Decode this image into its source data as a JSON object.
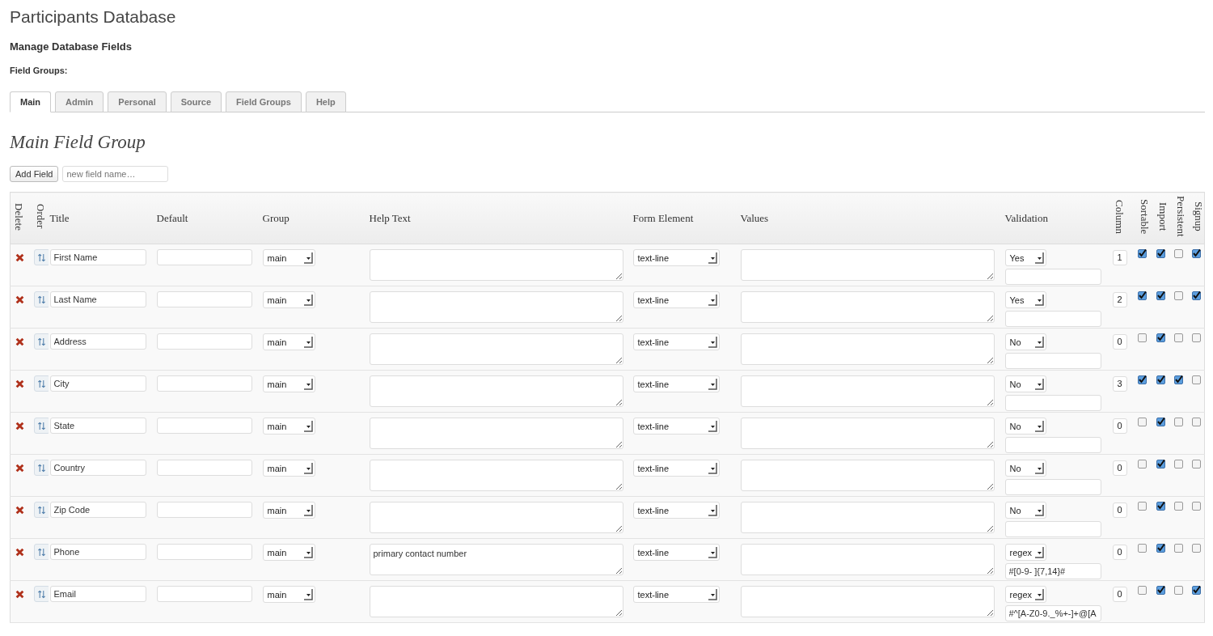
{
  "page_title": "Participants Database",
  "subtitle": "Manage Database Fields",
  "field_groups_label": "Field Groups:",
  "tabs": [
    {
      "label": "Main",
      "selected": true
    },
    {
      "label": "Admin",
      "selected": false
    },
    {
      "label": "Personal",
      "selected": false
    },
    {
      "label": "Source",
      "selected": false
    },
    {
      "label": "Field Groups",
      "selected": false
    },
    {
      "label": "Help",
      "selected": false
    }
  ],
  "section_title": "Main Field Group",
  "add_field": {
    "button": "Add Field",
    "placeholder": "new field name…"
  },
  "table": {
    "columns": [
      "Delete",
      "Order",
      "Title",
      "Default",
      "Group",
      "Help Text",
      "Form Element",
      "Values",
      "Validation",
      "Column",
      "Sortable",
      "Import",
      "Persistent",
      "Signup"
    ],
    "rows": [
      {
        "title": "First Name",
        "group": "main",
        "help": "",
        "element": "text-line",
        "validation": "Yes",
        "regex": "",
        "column": "1",
        "sortable": true,
        "import": true,
        "persistent": false,
        "signup": true
      },
      {
        "title": "Last Name",
        "group": "main",
        "help": "",
        "element": "text-line",
        "validation": "Yes",
        "regex": "",
        "column": "2",
        "sortable": true,
        "import": true,
        "persistent": false,
        "signup": true
      },
      {
        "title": "Address",
        "group": "main",
        "help": "",
        "element": "text-line",
        "validation": "No",
        "regex": "",
        "column": "0",
        "sortable": false,
        "import": true,
        "persistent": false,
        "signup": false
      },
      {
        "title": "City",
        "group": "main",
        "help": "",
        "element": "text-line",
        "validation": "No",
        "regex": "",
        "column": "3",
        "sortable": true,
        "import": true,
        "persistent": true,
        "signup": false
      },
      {
        "title": "State",
        "group": "main",
        "help": "",
        "element": "text-line",
        "validation": "No",
        "regex": "",
        "column": "0",
        "sortable": false,
        "import": true,
        "persistent": false,
        "signup": false
      },
      {
        "title": "Country",
        "group": "main",
        "help": "",
        "element": "text-line",
        "validation": "No",
        "regex": "",
        "column": "0",
        "sortable": false,
        "import": true,
        "persistent": false,
        "signup": false
      },
      {
        "title": "Zip Code",
        "group": "main",
        "help": "",
        "element": "text-line",
        "validation": "No",
        "regex": "",
        "column": "0",
        "sortable": false,
        "import": true,
        "persistent": false,
        "signup": false
      },
      {
        "title": "Phone",
        "group": "main",
        "help": "primary contact number",
        "element": "text-line",
        "validation": "regex",
        "regex": "#[0-9- ]{7,14}#",
        "column": "0",
        "sortable": false,
        "import": true,
        "persistent": false,
        "signup": false
      },
      {
        "title": "Email",
        "group": "main",
        "help": "",
        "element": "text-line",
        "validation": "regex",
        "regex": "#^[A-Z0-9._%+-]+@[A",
        "column": "0",
        "sortable": false,
        "import": true,
        "persistent": false,
        "signup": true
      }
    ]
  }
}
